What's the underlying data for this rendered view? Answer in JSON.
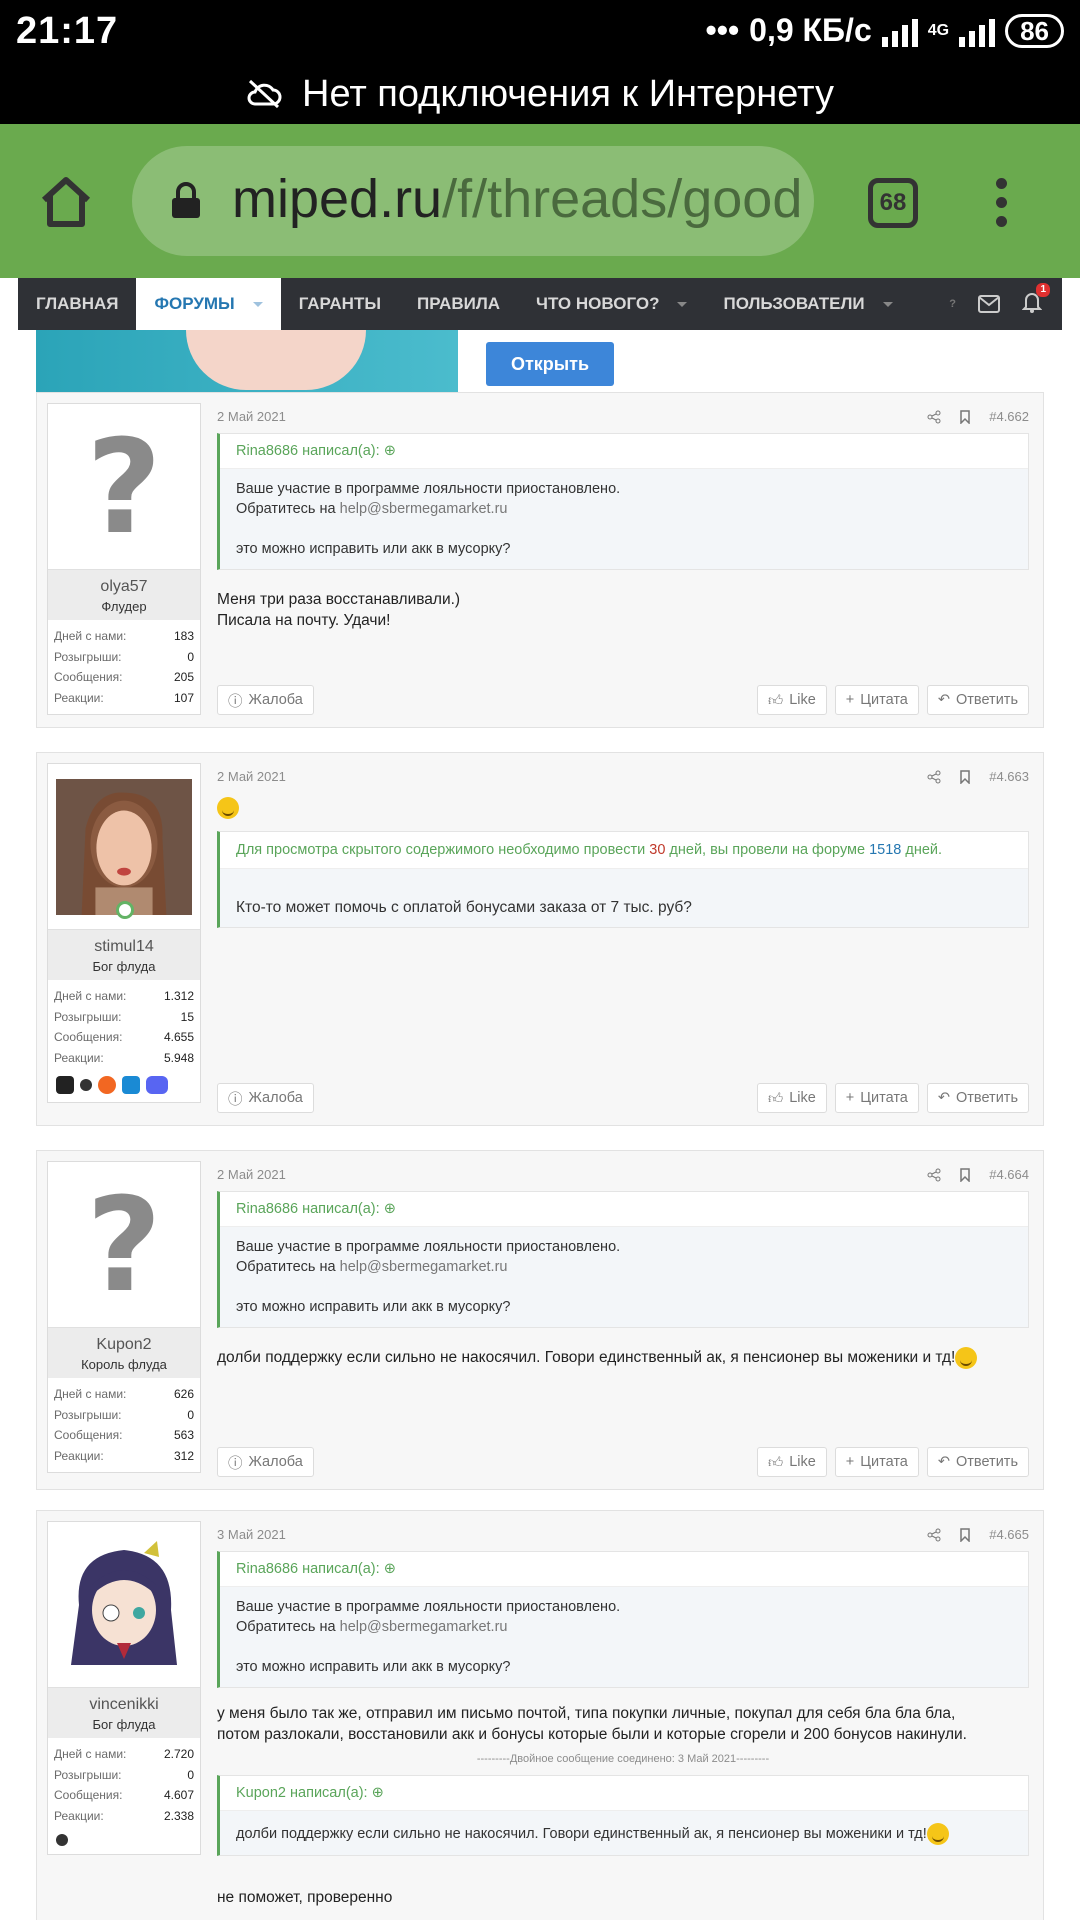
{
  "status": {
    "time": "21:17",
    "speed": "0,9 КБ/с",
    "network": "4G",
    "battery": "86"
  },
  "offline_banner": "Нет подключения к Интернету",
  "browser": {
    "url_host": "miped.ru",
    "url_path": "/f/threads/good",
    "tabs_count": "68"
  },
  "nav": {
    "items": [
      "ГЛАВНАЯ",
      "ФОРУМЫ",
      "ГАРАНТЫ",
      "ПРАВИЛА",
      "ЧТО НОВОГО?",
      "ПОЛЬЗОВАТЕЛИ"
    ],
    "notif_count": "1"
  },
  "ad": {
    "open_label": "Открыть"
  },
  "stat_labels": {
    "days": "Дней с нами:",
    "draws": "Розыгрыши:",
    "messages": "Сообщения:",
    "reactions": "Реакции:"
  },
  "buttons": {
    "report": "Жалоба",
    "like": "Like",
    "quote": "Цитата",
    "reply": "Ответить"
  },
  "posts": [
    {
      "user": {
        "name": "olya57",
        "title": "Флудер",
        "days": "183",
        "draws": "0",
        "messages": "205",
        "reactions": "107"
      },
      "date": "2 Май 2021",
      "number": "#4.662",
      "quote_author": "Rina8686 написал(а):",
      "quote_lines": [
        "Ваше участие в программе лояльности приостановлено.",
        "Обратитесь на ",
        "help@sbermegamarket.ru",
        "это можно исправить или акк в мусорку?"
      ],
      "text": [
        "Меня три раза восстанавливали.)",
        "Писала на почту. Удачи!"
      ]
    },
    {
      "user": {
        "name": "stimul14",
        "title": "Бог флуда",
        "days": "1.312",
        "draws": "15",
        "messages": "4.655",
        "reactions": "5.948"
      },
      "date": "2 Май 2021",
      "number": "#4.663",
      "hidden": {
        "pre": "Для просмотра скрытого содержимого необходимо провести ",
        "need": "30",
        "mid": " дней, вы провели на форуме ",
        "have": "1518",
        "post": " дней."
      },
      "hidden_text": "Кто-то может помочь с оплатой бонусами заказа от 7 тыс. руб?"
    },
    {
      "user": {
        "name": "Kupon2",
        "title": "Король флуда",
        "days": "626",
        "draws": "0",
        "messages": "563",
        "reactions": "312"
      },
      "date": "2 Май 2021",
      "number": "#4.664",
      "quote_author": "Rina8686 написал(а):",
      "quote_lines": [
        "Ваше участие в программе лояльности приостановлено.",
        "Обратитесь на ",
        "help@sbermegamarket.ru",
        "это можно исправить или акк в мусорку?"
      ],
      "text": [
        "долби поддержку если сильно не накосячил. Говори единственный ак, я пенсионер вы моженики и тд!"
      ]
    },
    {
      "user": {
        "name": "vincenikki",
        "title": "Бог флуда",
        "days": "2.720",
        "draws": "0",
        "messages": "4.607",
        "reactions": "2.338"
      },
      "date": "3 Май 2021",
      "number": "#4.665",
      "quote_author": "Rina8686 написал(а):",
      "quote_lines": [
        "Ваше участие в программе лояльности приостановлено.",
        "Обратитесь на ",
        "help@sbermegamarket.ru",
        "это можно исправить или акк в мусорку?"
      ],
      "text": [
        "у меня было так же, отправил им письмо почтой, типа покупки личные, покупал для себя бла бла бла,",
        "потом разлокали, восстановили акк и бонусы которые были и которые сгорели и 200 бонусов накинули."
      ],
      "merged_note": "---------Двойное сообщение соединено: 3 Май 2021---------",
      "quote2_author": "Kupon2 написал(а):",
      "quote2_text": "долби поддержку если сильно не накосячил. Говори единственный ак, я пенсионер вы моженики и тд!",
      "text2": "не поможет, проверенно"
    }
  ]
}
